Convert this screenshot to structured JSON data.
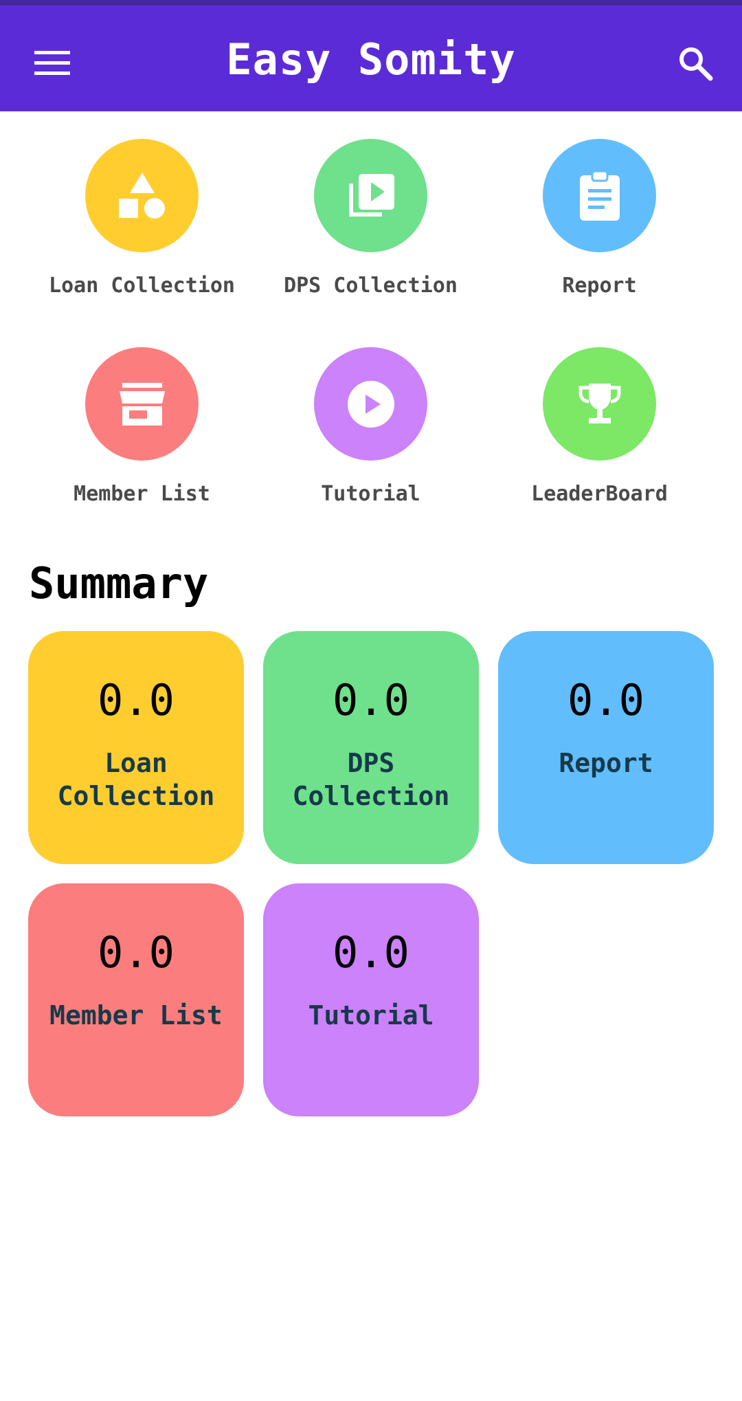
{
  "app_bar": {
    "title": "Easy Somity",
    "menu_icon": "hamburger-menu-icon",
    "search_icon": "search-icon",
    "background_color": "#5c2bd8"
  },
  "menu": {
    "items": [
      {
        "label": "Loan Collection",
        "icon": "shapes-icon",
        "color": "#ffcd2e"
      },
      {
        "label": "DPS Collection",
        "icon": "video-library-icon",
        "color": "#6fe08c"
      },
      {
        "label": "Report",
        "icon": "clipboard-icon",
        "color": "#62bdfc"
      },
      {
        "label": "Member List",
        "icon": "storefront-icon",
        "color": "#fc7d7d"
      },
      {
        "label": "Tutorial",
        "icon": "play-circle-icon",
        "color": "#cb82fa"
      },
      {
        "label": "LeaderBoard",
        "icon": "trophy-icon",
        "color": "#7ce866"
      }
    ]
  },
  "summary": {
    "title": "Summary",
    "cards": [
      {
        "value": "0.0",
        "label": "Loan Collection",
        "color": "#ffcd2e"
      },
      {
        "value": "0.0",
        "label": "DPS Collection",
        "color": "#6fe08c"
      },
      {
        "value": "0.0",
        "label": "Report",
        "color": "#62bdfc"
      },
      {
        "value": "0.0",
        "label": "Member List",
        "color": "#fc7d7d"
      },
      {
        "value": "0.0",
        "label": "Tutorial",
        "color": "#cb82fa"
      }
    ]
  }
}
